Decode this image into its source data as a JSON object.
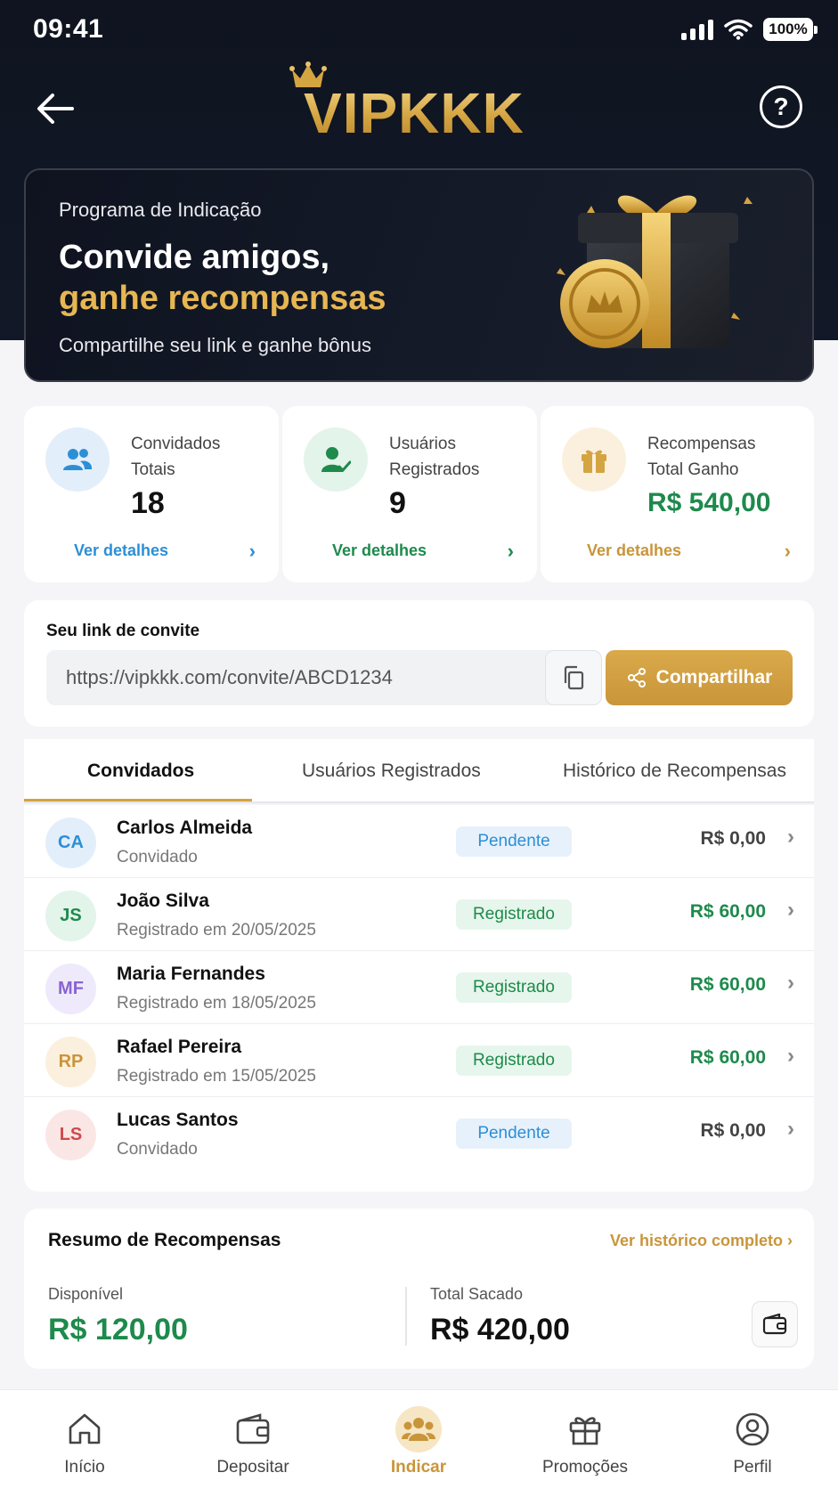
{
  "status": {
    "time": "09:41",
    "battery": "100%"
  },
  "brand": {
    "name": "VIPKKK",
    "gold": "#d4a441"
  },
  "banner": {
    "eyebrow": "Programa de Indicação",
    "title_line1": "Convide amigos,",
    "title_line2": "ganhe recompensas",
    "subtitle": "Compartilhe seu link e ganhe bônus"
  },
  "stats": [
    {
      "label_line1": "Convidados",
      "label_line2": "Totais",
      "value": "18",
      "link": "Ver detalhes",
      "color": "#2c8fd6",
      "icon": "users-icon"
    },
    {
      "label_line1": "Usuários",
      "label_line2": "Registrados",
      "value": "9",
      "link": "Ver detalhes",
      "color": "#1e8a4c",
      "icon": "user-check-icon"
    },
    {
      "label_line1": "Recompensas",
      "label_line2": "Total Ganho",
      "value": "R$ 540,00",
      "link": "Ver detalhes",
      "color": "#c9953a",
      "icon": "gift-icon"
    }
  ],
  "invite": {
    "label": "Seu link de convite",
    "url": "https://vipkkk.com/convite/ABCD1234",
    "share_label": "Compartilhar"
  },
  "tabs": [
    {
      "label": "Convidados",
      "active": true
    },
    {
      "label": "Usuários Registrados",
      "active": false
    },
    {
      "label": "Histórico de Recompensas",
      "active": false
    }
  ],
  "invitees": [
    {
      "initials": "CA",
      "name": "Carlos Almeida",
      "sub": "Convidado",
      "status": "Pendente",
      "amount": "R$ 0,00"
    },
    {
      "initials": "JS",
      "name": "João Silva",
      "sub": "Registrado em 20/05/2025",
      "status": "Registrado",
      "amount": "R$ 60,00"
    },
    {
      "initials": "MF",
      "name": "Maria Fernandes",
      "sub": "Registrado em 18/05/2025",
      "status": "Registrado",
      "amount": "R$ 60,00"
    },
    {
      "initials": "RP",
      "name": "Rafael Pereira",
      "sub": "Registrado em 15/05/2025",
      "status": "Registrado",
      "amount": "R$ 60,00"
    },
    {
      "initials": "LS",
      "name": "Lucas Santos",
      "sub": "Convidado",
      "status": "Pendente",
      "amount": "R$ 0,00"
    }
  ],
  "summary": {
    "title": "Resumo de Recompensas",
    "link": "Ver histórico completo",
    "available_label": "Disponível",
    "available_value": "R$ 120,00",
    "withdrawn_label": "Total Sacado",
    "withdrawn_value": "R$ 420,00"
  },
  "nav": [
    {
      "label": "Início",
      "icon": "home-icon",
      "active": false
    },
    {
      "label": "Depositar",
      "icon": "wallet-icon",
      "active": false
    },
    {
      "label": "Indicar",
      "icon": "group-icon",
      "active": true
    },
    {
      "label": "Promoções",
      "icon": "gift-icon",
      "active": false
    },
    {
      "label": "Perfil",
      "icon": "profile-icon",
      "active": false
    }
  ]
}
